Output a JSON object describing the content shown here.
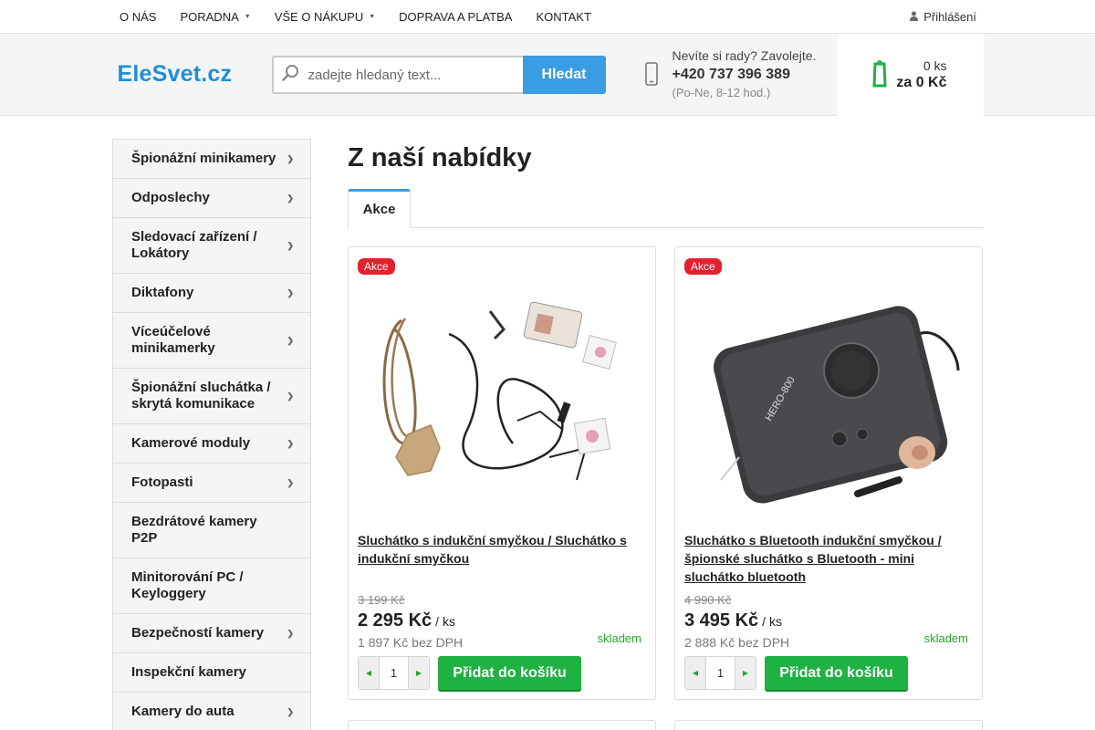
{
  "topnav": {
    "items": [
      {
        "label": "O NÁS",
        "caret": false
      },
      {
        "label": "PORADNA",
        "caret": true
      },
      {
        "label": "VŠE O NÁKUPU",
        "caret": true
      },
      {
        "label": "DOPRAVA A PLATBA",
        "caret": false
      },
      {
        "label": "KONTAKT",
        "caret": false
      }
    ],
    "login_label": "Přihlášení"
  },
  "header": {
    "logo": "EleSvet.cz",
    "search": {
      "placeholder": "zadejte hledaný text...",
      "button_label": "Hledat"
    },
    "contact": {
      "question": "Nevíte si rady? Zavolejte.",
      "phone": "+420 737 396 389",
      "hours": "(Po-Ne, 8-12 hod.)"
    },
    "cart": {
      "count": "0 ks",
      "total": "za 0 Kč"
    }
  },
  "sidebar": {
    "items": [
      {
        "label": "Špionážní minikamery",
        "arrow": true
      },
      {
        "label": "Odposlechy",
        "arrow": true
      },
      {
        "label": "Sledovací zařízení / Lokátory",
        "arrow": true
      },
      {
        "label": "Diktafony",
        "arrow": true
      },
      {
        "label": "Víceúčelové minikamerky",
        "arrow": true
      },
      {
        "label": "Špionážní sluchátka / skrytá komunikace",
        "arrow": true
      },
      {
        "label": "Kamerové moduly",
        "arrow": true
      },
      {
        "label": "Fotopasti",
        "arrow": true
      },
      {
        "label": "Bezdrátové kamery P2P",
        "arrow": false
      },
      {
        "label": "Minitorování PC / Keyloggery",
        "arrow": false
      },
      {
        "label": "Bezpečností kamery",
        "arrow": true
      },
      {
        "label": "Inspekční kamery",
        "arrow": false
      },
      {
        "label": "Kamery do auta",
        "arrow": true
      }
    ]
  },
  "content": {
    "heading": "Z naší nabídky",
    "tab_label": "Akce",
    "products": [
      {
        "badge": "Akce",
        "name": "Sluchátko s indukční smyčkou / Sluchátko s indukční smyčkou",
        "old_price": "3 199 Kč",
        "price": "2 295 Kč",
        "unit": "/ ks",
        "net_price": "1 897 Kč bez DPH",
        "stock": "skladem",
        "quantity": "1",
        "add_label": "Přidat do košíku"
      },
      {
        "badge": "Akce",
        "name": "Sluchátko s Bluetooth indukční smyčkou / špionské sluchátko s Bluetooth - mini sluchátko bluetooth",
        "old_price": "4 990 Kč",
        "price": "3 495 Kč",
        "unit": "/ ks",
        "net_price": "2 888 Kč bez DPH",
        "stock": "skladem",
        "quantity": "1",
        "add_label": "Přidat do košíku"
      }
    ]
  },
  "colors": {
    "accent": "#3a9ce2",
    "sale_badge": "#e5202e",
    "cart_button": "#1fb142",
    "stock": "#2aa52a"
  },
  "icons": {
    "login": "user-icon",
    "search": "magnifier-icon",
    "phone": "phone-icon",
    "cart": "cart-icon",
    "sidebar_arrow": "chevron-right-icon",
    "qty_minus": "minus-icon",
    "qty_plus": "plus-icon"
  }
}
